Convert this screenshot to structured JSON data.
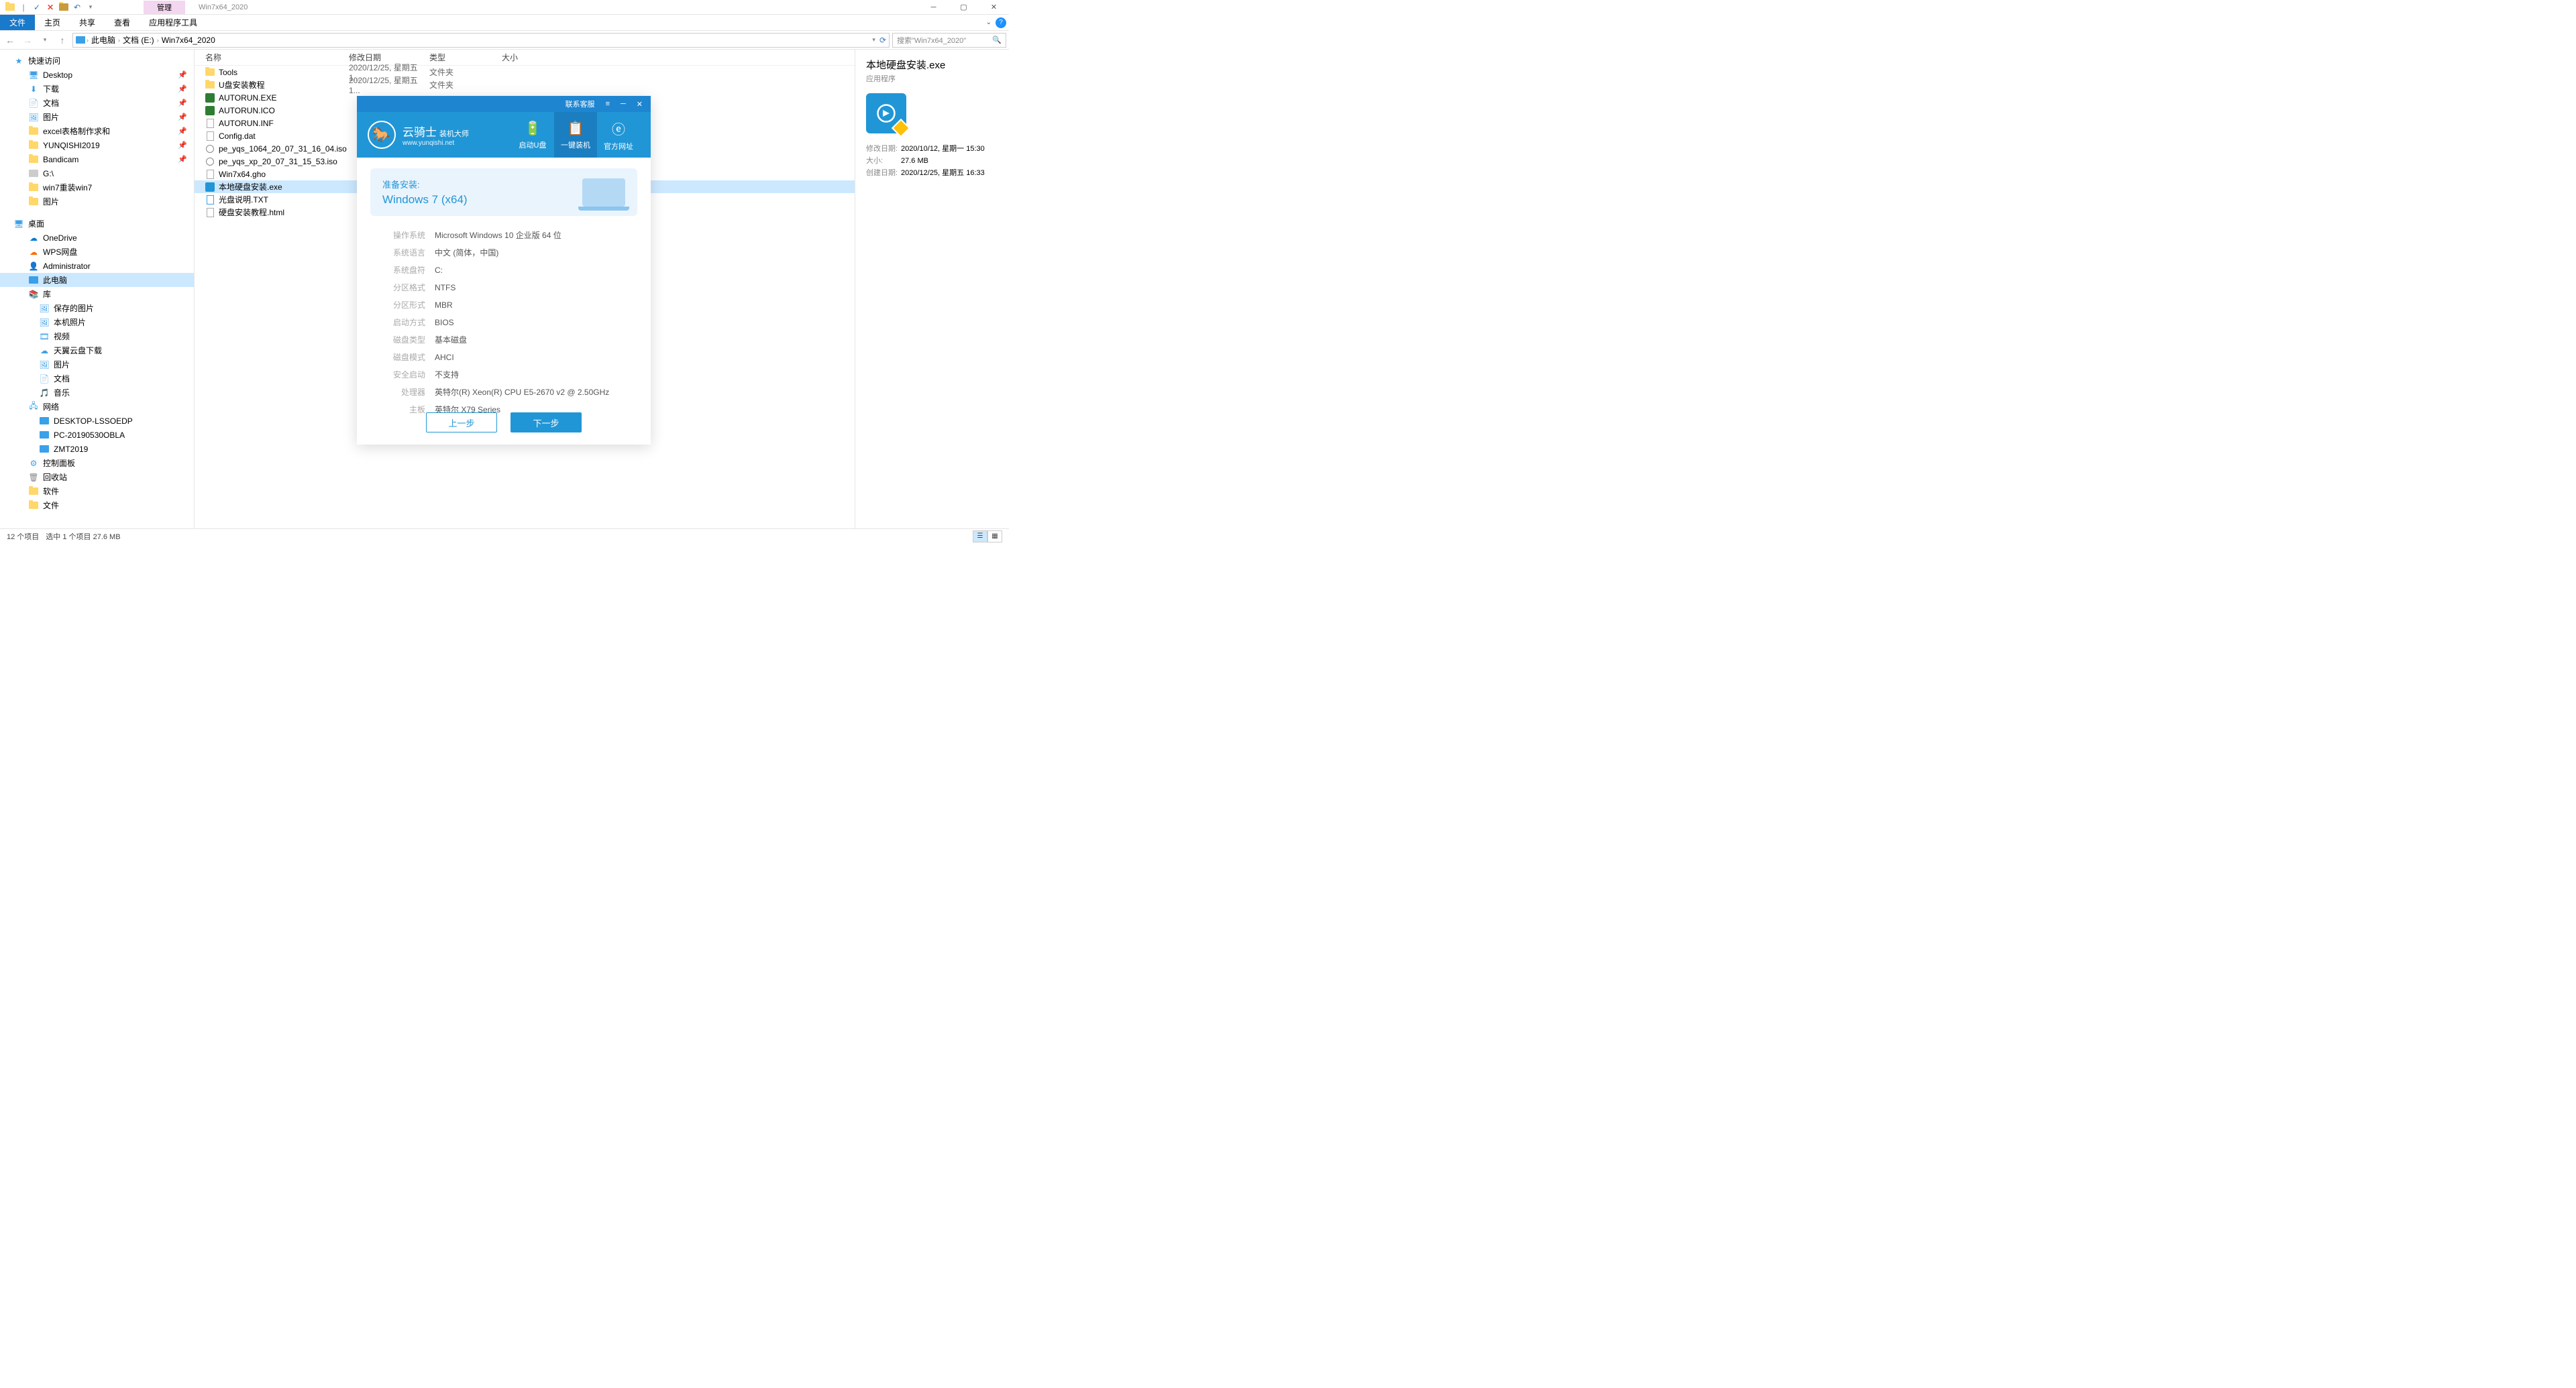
{
  "window": {
    "title": "Win7x64_2020",
    "manage_tab": "管理"
  },
  "ribbon": {
    "file": "文件",
    "home": "主页",
    "share": "共享",
    "view": "查看",
    "apptools": "应用程序工具"
  },
  "breadcrumb": {
    "root": "此电脑",
    "drive": "文档 (E:)",
    "folder": "Win7x64_2020"
  },
  "search": {
    "placeholder": "搜索\"Win7x64_2020\""
  },
  "sidebar": {
    "quick_access": "快速访问",
    "desktop": "Desktop",
    "downloads": "下载",
    "documents": "文档",
    "pictures": "图片",
    "excel": "excel表格制作求和",
    "yunqishi": "YUNQISHI2019",
    "bandicam": "Bandicam",
    "gdrive": "G:\\",
    "win7reinstall": "win7重装win7",
    "pictures2": "图片",
    "desktop_root": "桌面",
    "onedrive": "OneDrive",
    "wps": "WPS网盘",
    "admin": "Administrator",
    "thispc": "此电脑",
    "libraries": "库",
    "saved_pics": "保存的图片",
    "camera_roll": "本机照片",
    "videos": "视频",
    "tianyi": "天翼云盘下载",
    "lib_pics": "图片",
    "lib_docs": "文档",
    "lib_music": "音乐",
    "network": "网络",
    "net1": "DESKTOP-LSSOEDP",
    "net2": "PC-20190530OBLA",
    "net3": "ZMT2019",
    "control_panel": "控制面板",
    "recycle": "回收站",
    "software": "软件",
    "files": "文件"
  },
  "columns": {
    "name": "名称",
    "date": "修改日期",
    "type": "类型",
    "size": "大小"
  },
  "files": [
    {
      "name": "Tools",
      "date": "2020/12/25, 星期五 1...",
      "type": "文件夹",
      "icon": "folder"
    },
    {
      "name": "U盘安装教程",
      "date": "2020/12/25, 星期五 1...",
      "type": "文件夹",
      "icon": "folder"
    },
    {
      "name": "AUTORUN.EXE",
      "date": "",
      "type": "",
      "icon": "exe-green"
    },
    {
      "name": "AUTORUN.ICO",
      "date": "",
      "type": "",
      "icon": "ico"
    },
    {
      "name": "AUTORUN.INF",
      "date": "",
      "type": "",
      "icon": "file"
    },
    {
      "name": "Config.dat",
      "date": "",
      "type": "",
      "icon": "file"
    },
    {
      "name": "pe_yqs_1064_20_07_31_16_04.iso",
      "date": "",
      "type": "",
      "icon": "disc"
    },
    {
      "name": "pe_yqs_xp_20_07_31_15_53.iso",
      "date": "",
      "type": "",
      "icon": "disc"
    },
    {
      "name": "Win7x64.gho",
      "date": "",
      "type": "",
      "icon": "file"
    },
    {
      "name": "本地硬盘安装.exe",
      "date": "",
      "type": "",
      "icon": "exe-blue",
      "selected": true
    },
    {
      "name": "光盘说明.TXT",
      "date": "",
      "type": "",
      "icon": "txt"
    },
    {
      "name": "硬盘安装教程.html",
      "date": "",
      "type": "",
      "icon": "file"
    }
  ],
  "details": {
    "title": "本地硬盘安装.exe",
    "type": "应用程序",
    "modified_label": "修改日期:",
    "modified": "2020/10/12, 星期一 15:30",
    "size_label": "大小:",
    "size": "27.6 MB",
    "created_label": "创建日期:",
    "created": "2020/12/25, 星期五 16:33"
  },
  "statusbar": {
    "items": "12 个项目",
    "selected": "选中 1 个项目  27.6 MB"
  },
  "installer": {
    "titlebar_contact": "联系客服",
    "logo_main": "云骑士",
    "logo_sub1": "装机大师",
    "logo_sub2": "www.yunqishi.net",
    "tab_usb": "启动U盘",
    "tab_install": "一键装机",
    "tab_site": "官方网址",
    "prepare_label": "准备安装:",
    "prepare_os": "Windows 7 (x64)",
    "rows": [
      {
        "label": "操作系统",
        "value": "Microsoft Windows 10 企业版 64 位"
      },
      {
        "label": "系统语言",
        "value": "中文 (简体，中国)"
      },
      {
        "label": "系统盘符",
        "value": "C:"
      },
      {
        "label": "分区格式",
        "value": "NTFS"
      },
      {
        "label": "分区形式",
        "value": "MBR"
      },
      {
        "label": "启动方式",
        "value": "BIOS"
      },
      {
        "label": "磁盘类型",
        "value": "基本磁盘"
      },
      {
        "label": "磁盘模式",
        "value": "AHCI"
      },
      {
        "label": "安全启动",
        "value": "不支持"
      },
      {
        "label": "处理器",
        "value": "英特尔(R) Xeon(R) CPU E5-2670 v2 @ 2.50GHz"
      },
      {
        "label": "主板",
        "value": "英特尔 X79 Series"
      }
    ],
    "btn_prev": "上一步",
    "btn_next": "下一步"
  }
}
